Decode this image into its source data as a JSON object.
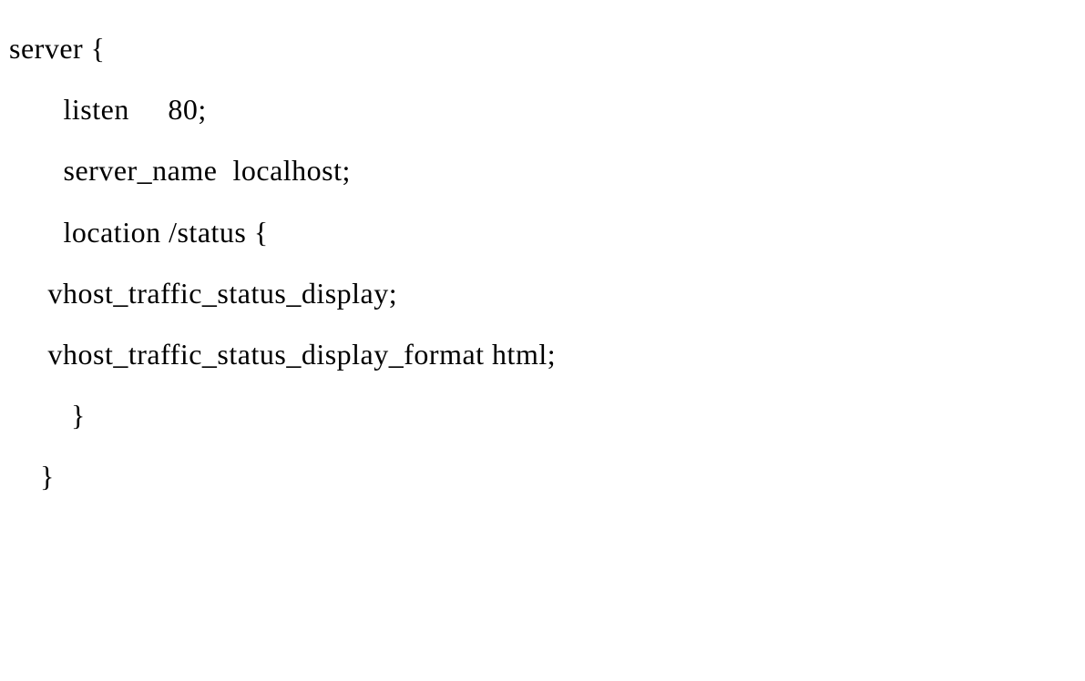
{
  "config_type": "nginx",
  "lines": [
    "server {",
    "       listen     80;",
    "       server_name  localhost;",
    "       location /status {",
    "     vhost_traffic_status_display;",
    "     vhost_traffic_status_display_format html;",
    "        }",
    "    }"
  ]
}
